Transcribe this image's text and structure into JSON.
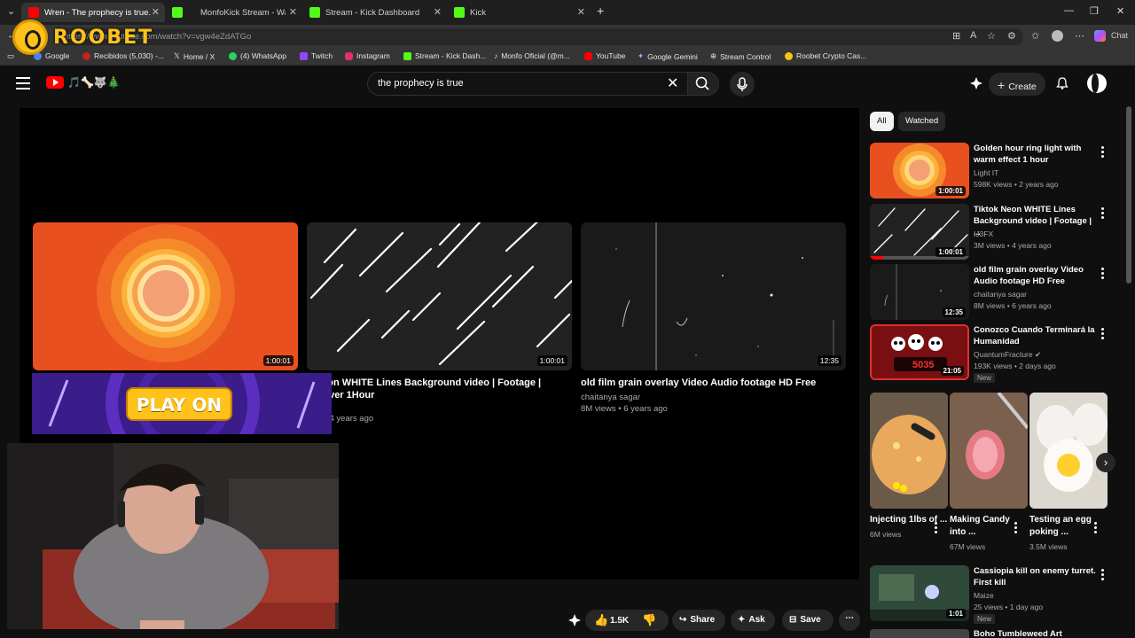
{
  "browser": {
    "tabs": [
      {
        "label": "Wren - The prophecy is true. - You",
        "color": "#ff0000"
      },
      {
        "label": "MonfoKick Stream - Watch Li",
        "color": "#53fc18"
      },
      {
        "label": "Stream - Kick Dashboard",
        "color": "#53fc18"
      },
      {
        "label": "Kick",
        "color": "#53fc18"
      }
    ],
    "new_tab": "+",
    "url": "https://www.youtube.com/watch?v=vgw4eZdATGo",
    "chat_label": "Chat",
    "bookmarks": [
      "Google",
      "Recibidos (5,030) -...",
      "Home / X",
      "(4) WhatsApp",
      "Twitch",
      "Instagram",
      "Stream - Kick Dash...",
      "Monfo Oficial (@m...",
      "YouTube",
      "Google Gemini",
      "Stream Control",
      "Roobet Crypto Cas..."
    ],
    "bookmark_colors": [
      "#4285f4",
      "#c5221f",
      "#ffffff",
      "#25d366",
      "#9146ff",
      "#e1306c",
      "#53fc18",
      "#ffffff",
      "#ff0000",
      "#8ab4f8",
      "#cccccc",
      "#ffc21a"
    ]
  },
  "overlay": {
    "logo_text": "ROOBET",
    "promo_button": "PLAY ON"
  },
  "youtube": {
    "logo_emoji": "🎵🦴🐺🎄",
    "search_value": "the prophecy is true",
    "create_label": "Create",
    "player": {
      "cards": [
        {
          "title": "",
          "channel": "",
          "meta": "",
          "duration": "1:00:01"
        },
        {
          "title": "k Neon WHITE Lines Background video | Footage | ensaver 1Hour",
          "channel": "",
          "meta": "ews • 4 years ago",
          "duration": "1:00:01"
        },
        {
          "title": "old film grain overlay Video Audio footage HD Free",
          "channel": "chaitanya sagar",
          "meta": "8M views • 6 years ago",
          "duration": "12:35"
        }
      ]
    },
    "actions": {
      "likes": "1.5K",
      "share": "Share",
      "ask": "Ask",
      "save": "Save"
    },
    "chips": [
      "All",
      "Watched"
    ],
    "sidebar": [
      {
        "title": "Golden hour ring light with warm effect 1 hour",
        "channel": "Light IT",
        "meta": "598K views • 2 years ago",
        "duration": "1:00:01",
        "new": ""
      },
      {
        "title": "Tiktok Neon WHITE Lines Background video | Footage | ...",
        "channel": "IJ3FX",
        "meta": "3M views • 4 years ago",
        "duration": "1:00:01",
        "new": ""
      },
      {
        "title": "old film grain overlay  Video Audio footage HD Free",
        "channel": "chaitanya sagar",
        "meta": "8M views • 6 years ago",
        "duration": "12:35",
        "new": ""
      },
      {
        "title": "Conozco Cuando Terminará la Humanidad",
        "channel": "QuantumFracture",
        "meta": "193K views • 2 days ago",
        "duration": "21:05",
        "new": "New"
      },
      {
        "title": "Cassiopia kill on enemy turret. First kill",
        "channel": "Maize",
        "meta": "25 views • 1 day ago",
        "duration": "1:01",
        "new": "New"
      }
    ],
    "thumb_text_5035": "5035",
    "shorts": [
      {
        "title": "Injecting 1lbs of ...",
        "views": "6M views"
      },
      {
        "title": "Making Candy into ...",
        "views": "67M views"
      },
      {
        "title": "Testing an egg poking ...",
        "views": "3.5M views"
      }
    ],
    "next_partial_title": "Boho Tumbleweed Art"
  }
}
